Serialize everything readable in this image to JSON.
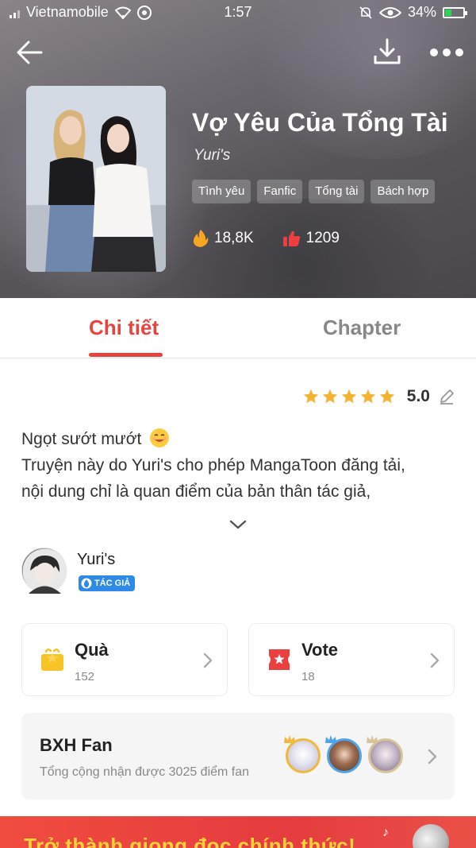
{
  "status_bar": {
    "carrier": "Vietnamobile",
    "time": "1:57",
    "battery": "34%",
    "battery_level": 0.34
  },
  "book": {
    "title": "Vợ Yêu Của Tổng Tài",
    "author": "Yuri's",
    "tags": [
      "Tình yêu",
      "Fanfic",
      "Tổng tài",
      "Bách hợp"
    ],
    "views": "18,8K",
    "likes": "1209"
  },
  "tabs": {
    "detail": "Chi tiết",
    "chapter": "Chapter"
  },
  "rating": {
    "score": "5.0",
    "stars": 5
  },
  "description": {
    "line1": "Ngọt sướt mướt",
    "line2": "Truyện này do Yuri's cho phép MangaToon đăng tải,",
    "line3": "nội dung chỉ là quan điểm của bản thân tác giả,"
  },
  "author_info": {
    "name": "Yuri's",
    "badge": "TÁC GIẢ"
  },
  "cards": {
    "gift_label": "Quà",
    "gift_count": "152",
    "vote_label": "Vote",
    "vote_count": "18"
  },
  "fan_rank": {
    "label": "BXH Fan",
    "sub": "Tổng cộng nhận được 3025 điểm fan"
  },
  "banner": {
    "text": "Trở thành giọng đọc chính thức!"
  },
  "colors": {
    "accent": "#e8433f",
    "star": "#f5b335",
    "badge": "#2e8ae6",
    "banner_text": "#ffd23c"
  }
}
